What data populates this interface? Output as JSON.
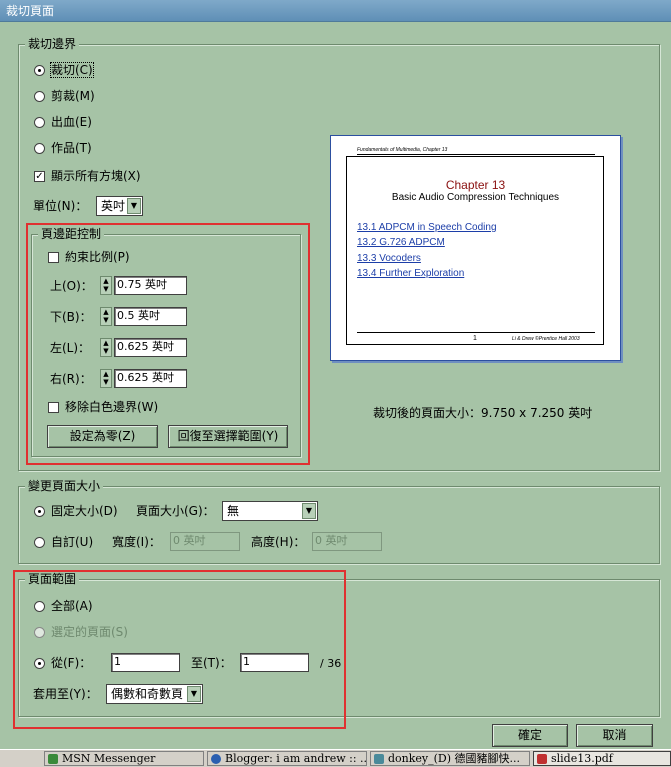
{
  "window": {
    "title": "裁切頁面"
  },
  "crop_margins": {
    "legend": "裁切邊界",
    "options": [
      {
        "label": "裁切(C)",
        "selected": true
      },
      {
        "label": "剪裁(M)",
        "selected": false
      },
      {
        "label": "出血(E)",
        "selected": false
      },
      {
        "label": "作品(T)",
        "selected": false
      }
    ],
    "show_all_boxes": {
      "label": "顯示所有方塊(X)",
      "checked": true
    },
    "units_label": "單位(N)：",
    "units_value": "英吋"
  },
  "margin_controls": {
    "legend": "頁邊距控制",
    "constrain": {
      "label": "約束比例(P)",
      "checked": false
    },
    "top": {
      "label": "上(O)：",
      "value": "0.75 英吋"
    },
    "bottom": {
      "label": "下(B)：",
      "value": "0.5 英吋"
    },
    "left": {
      "label": "左(L)：",
      "value": "0.625 英吋"
    },
    "right": {
      "label": "右(R)：",
      "value": "0.625 英吋"
    },
    "remove_white": {
      "label": "移除白色邊界(W)",
      "checked": false
    },
    "set_zero_button": "設定為零(Z)",
    "revert_button": "回復至選擇範圍(Y)"
  },
  "preview": {
    "header": "Fundamentals of Multimedia, Chapter 13",
    "chapter": "Chapter 13",
    "subtitle": "Basic Audio Compression Techniques",
    "links": [
      "13.1 ADPCM in Speech Coding",
      "13.2 G.726 ADPCM",
      "13.3 Vocoders",
      "13.4 Further Exploration"
    ],
    "page_number": "1",
    "footer": "Li & Drew ©Prentice Hall 2003",
    "size_text": "裁切後的頁面大小：9.750 x 7.250 英吋"
  },
  "page_size": {
    "legend": "變更頁面大小",
    "fixed": {
      "label": "固定大小(D)",
      "selected": true
    },
    "page_size_label": "頁面大小(G)：",
    "page_size_value": "無",
    "custom": {
      "label": "自訂(U)",
      "selected": false
    },
    "width_label": "寬度(I)：",
    "width_value": "0 英吋",
    "height_label": "高度(H)：",
    "height_value": "0 英吋"
  },
  "page_range": {
    "legend": "頁面範圍",
    "all": {
      "label": "全部(A)",
      "selected": false
    },
    "selected_pages": {
      "label": "選定的頁面(S)",
      "selected": false,
      "disabled": true
    },
    "from": {
      "label": "從(F)：",
      "selected": true,
      "value": "1"
    },
    "to_label": "至(T)：",
    "to_value": "1",
    "total": "/ 36",
    "apply_label": "套用至(Y)：",
    "apply_value": "偶數和奇數頁"
  },
  "buttons": {
    "ok": "確定",
    "cancel": "取消"
  },
  "taskbar": {
    "items": [
      {
        "label": "MSN Messenger",
        "color": "#3a8a3a"
      },
      {
        "label": "Blogger: i am andrew :: ...",
        "color": "#2a5fb0"
      },
      {
        "label": "donkey_(D) 德國豬腳快...",
        "color": "#4a8a9a"
      },
      {
        "label": "slide13.pdf",
        "color": "#c03030"
      }
    ]
  },
  "colors": {
    "dialog_bg": "#a6c3a6",
    "highlight_red": "#e03030",
    "link_blue": "#1c3ea8"
  }
}
